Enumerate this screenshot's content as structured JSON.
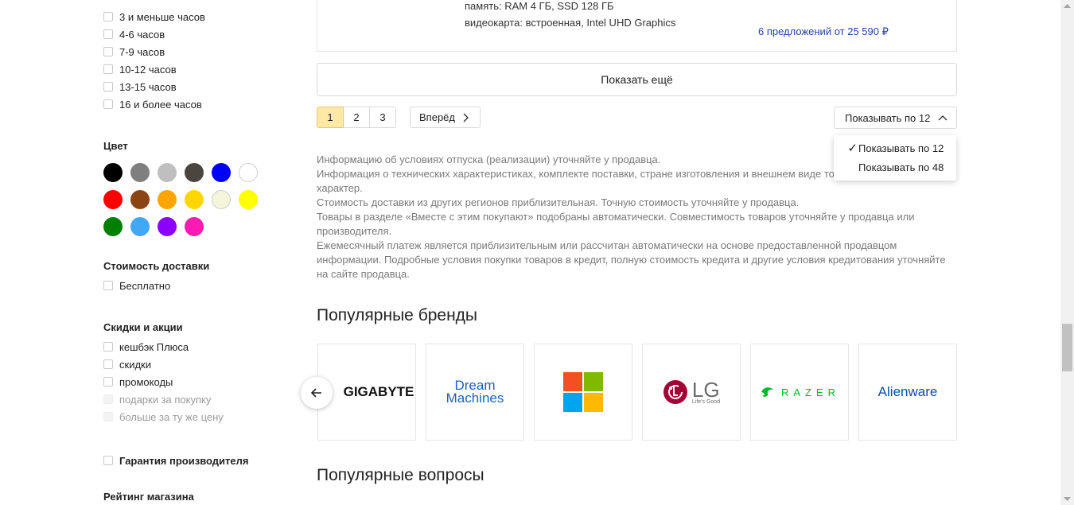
{
  "sidebar": {
    "battery_options": [
      {
        "label": "3 и меньше часов",
        "disabled": false
      },
      {
        "label": "4-6 часов",
        "disabled": false
      },
      {
        "label": "7-9 часов",
        "disabled": false
      },
      {
        "label": "10-12 часов",
        "disabled": false
      },
      {
        "label": "13-15 часов",
        "disabled": false
      },
      {
        "label": "16 и более часов",
        "disabled": false
      }
    ],
    "color_title": "Цвет",
    "colors": [
      "#000000",
      "#7f7f7f",
      "#bfbfbf",
      "#4b4540",
      "#0000ff",
      "#ffffff",
      "#ff0000",
      "#8b4513",
      "#ffa500",
      "#ffd700",
      "#f5f5dc",
      "#ffff00",
      "#008000",
      "#40a8f5",
      "#8b00ff",
      "#ff1ab3"
    ],
    "delivery_title": "Стоимость доставки",
    "delivery_options": [
      {
        "label": "Бесплатно",
        "disabled": false
      }
    ],
    "discounts_title": "Скидки и акции",
    "discount_options": [
      {
        "label": "кешбэк Плюса",
        "disabled": false
      },
      {
        "label": "скидки",
        "disabled": false
      },
      {
        "label": "промокоды",
        "disabled": false
      },
      {
        "label": "подарки за покупку",
        "disabled": true
      },
      {
        "label": "больше за ту же цену",
        "disabled": true
      }
    ],
    "warranty_label": "Гарантия производителя",
    "rating_title": "Рейтинг магазина"
  },
  "product": {
    "spec_memory": "память: RAM 4 ГБ, SSD 128 ГБ",
    "spec_video": "видеокарта: встроенная, Intel UHD Graphics",
    "offers": "6 предложений от 25 590 ₽"
  },
  "show_more_label": "Показать ещё",
  "pagination": {
    "pages": [
      "1",
      "2",
      "3"
    ],
    "active_page": "1",
    "next_label": "Вперёд"
  },
  "per_page": {
    "button_label": "Показывать по 12",
    "options": [
      {
        "label": "Показывать по 12",
        "selected": true
      },
      {
        "label": "Показывать по 48",
        "selected": false
      }
    ]
  },
  "disclaimer_lines": [
    "Информацию об условиях отпуска (реализации) уточняйте у продавца.",
    "Информация о технических характеристиках, комплекте поставки, стране изготовления и внешнем виде тов",
    "характер.",
    "Стоимость доставки из других регионов приблизительная. Точную стоимость уточняйте у продавца.",
    "Товары в разделе «Вместе с этим покупают» подобраны автоматически. Совместимость товаров уточняйте у продавца или",
    "производителя.",
    "Ежемесячный платеж является приблизительным или рассчитан автоматически на основе предоставленной продавцом",
    "информации. Подробные условия покупки товаров в кредит, полную стоимость кредита и другие условия кредитования уточняйте",
    "на сайте продавца."
  ],
  "popular_brands_title": "Популярные бренды",
  "brands": [
    {
      "name": "GIGABYTE",
      "icon": "gigabyte-logo"
    },
    {
      "name": "Dream Machines",
      "line1": "Dream",
      "line2": "Machines",
      "icon": "dream-machines-logo"
    },
    {
      "name": "Microsoft",
      "icon": "microsoft-logo"
    },
    {
      "name": "LG",
      "tagline": "Life's Good",
      "icon": "lg-logo"
    },
    {
      "name": "RAZER",
      "icon": "razer-logo"
    },
    {
      "name": "Alienware",
      "icon": "alienware-logo"
    }
  ],
  "popular_questions_title": "Популярные вопросы"
}
